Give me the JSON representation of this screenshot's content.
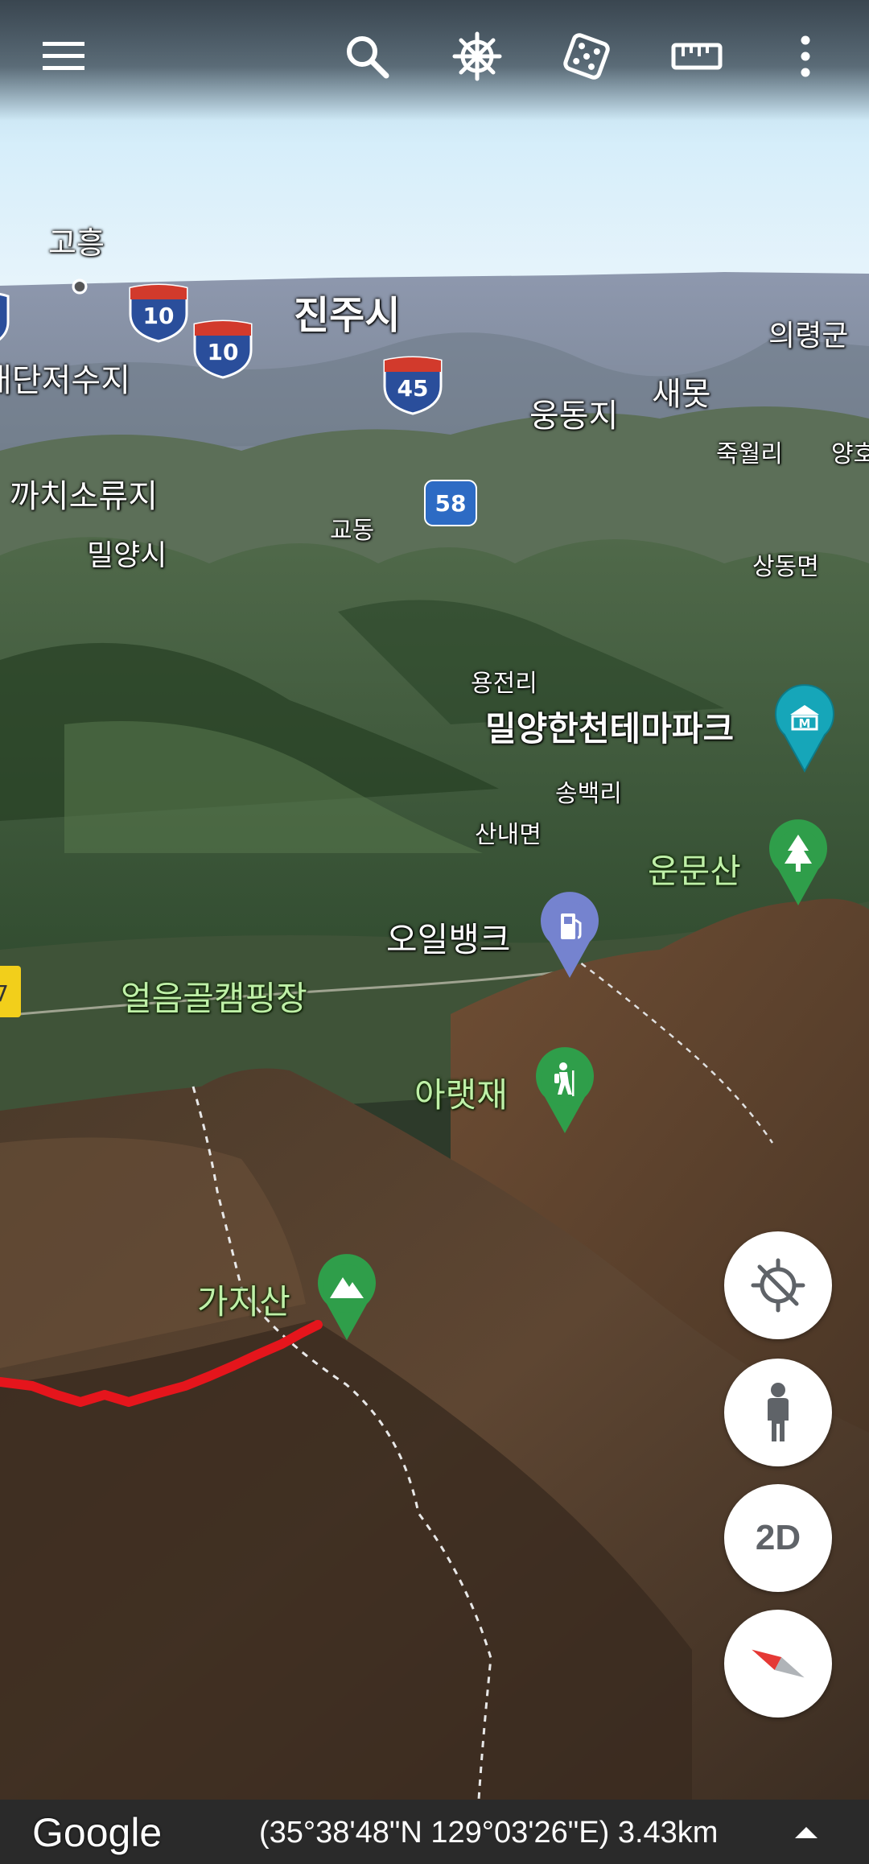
{
  "toolbar": {
    "menu_icon": "hamburger-menu-icon",
    "search_icon": "search-icon",
    "voyager_icon": "ship-wheel-icon",
    "feeling_lucky_icon": "dice-icon",
    "measure_icon": "ruler-icon",
    "more_icon": "more-vertical-icon"
  },
  "map": {
    "labels": {
      "goheung": "고흥",
      "jinju": "진주시",
      "uiryeong": "의령군",
      "saemot": "새못",
      "ungdongji": "웅동지",
      "jukwolri": "죽월리",
      "yangho": "양호",
      "dangeojeosuji": "대단저수지",
      "kkachisoryuji": "까치소류지",
      "gyodong": "교동",
      "miryang": "밀양시",
      "sangdongmyeon": "상동면",
      "yongjeonri": "용전리",
      "songbaekri": "송백리",
      "sannaemyeon": "산내면",
      "miryang_themepark": "밀양한천테마파크",
      "unmunsan": "운문산",
      "oilbank": "오일뱅크",
      "eoreumgol_camping": "얼음골캠핑장",
      "araetjae": "아랫재",
      "gajisan": "가지산",
      "edge_route": "7"
    },
    "shields": {
      "i10_a": "10",
      "i10_b": "10",
      "i45": "45",
      "r58": "58"
    }
  },
  "controls": {
    "location_icon": "location-disabled-icon",
    "pegman_icon": "pegman-icon",
    "view_mode": "2D",
    "compass_icon": "compass-icon"
  },
  "footer": {
    "brand": "Google",
    "coordinates": "(35°38'48\"N 129°03'26\"E) 3.43km",
    "expand_icon": "caret-up-icon"
  },
  "colors": {
    "sky": "#cfe9f7",
    "route": "#e5151c",
    "pin_green": "#2f9e4a",
    "pin_teal": "#16a6b9",
    "pin_purple": "#7583cf",
    "shield_blue": "#2a4e9b",
    "shield_red": "#d23a2c"
  }
}
